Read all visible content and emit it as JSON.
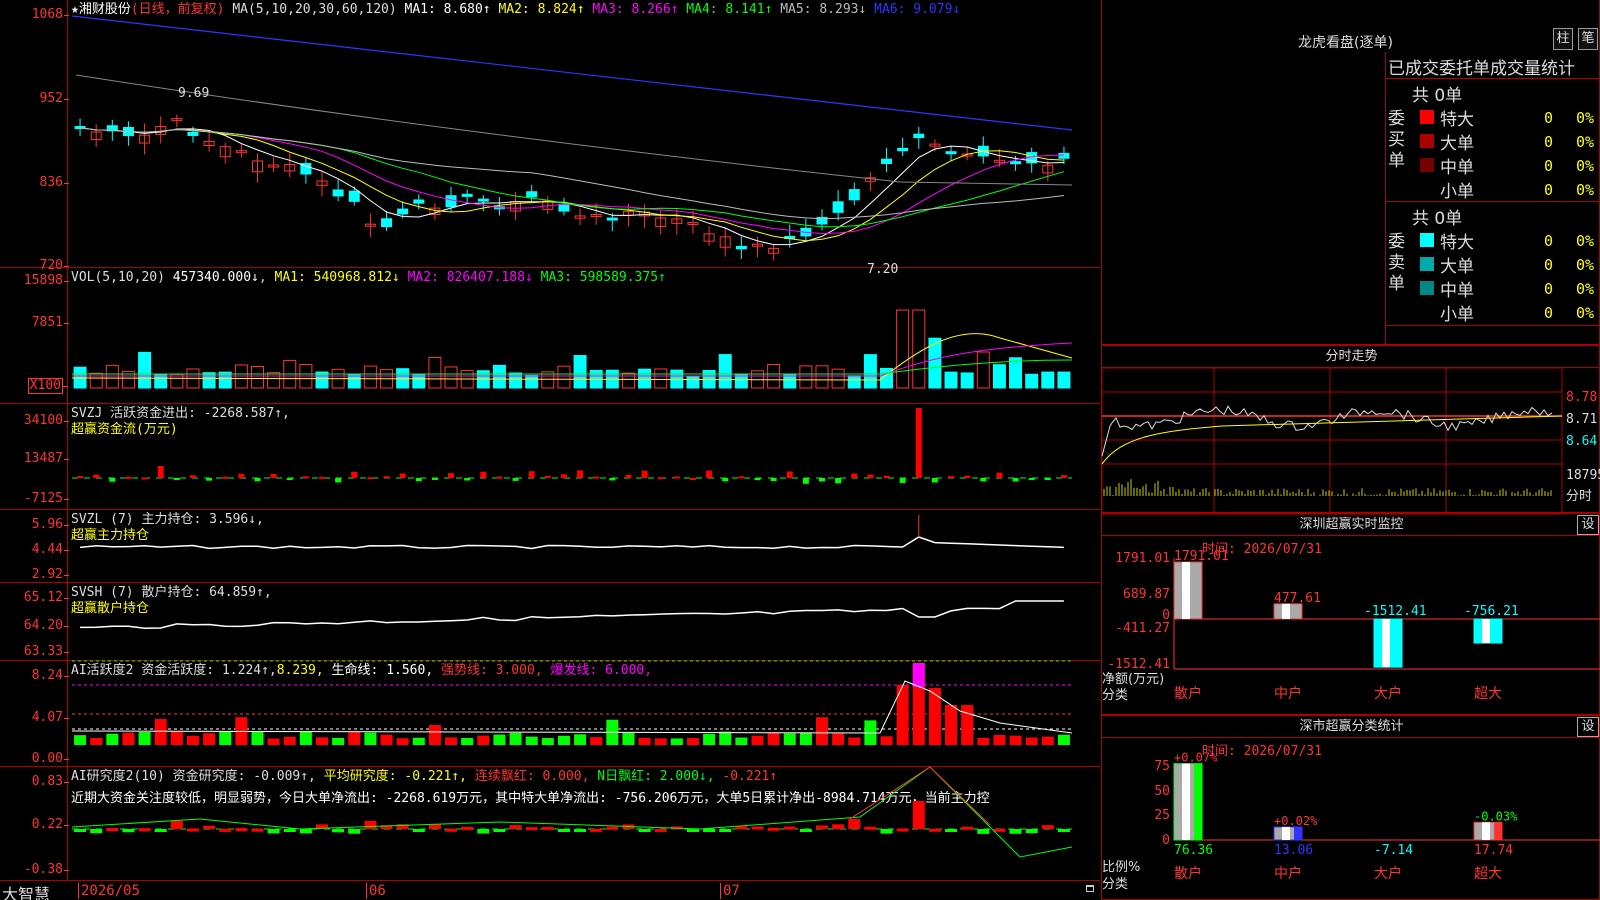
{
  "stock": {
    "star": "★",
    "name": "湘财股份",
    "period": "(日线，前复权)"
  },
  "ma": {
    "label": "MA(5,10,20,30,60,120)",
    "items": [
      {
        "t": "MA1: 8.680↑",
        "c": "#fff"
      },
      {
        "t": "MA2: 8.824↑",
        "c": "#ff0"
      },
      {
        "t": "MA3: 8.266↑",
        "c": "#f0f"
      },
      {
        "t": "MA4: 8.141↑",
        "c": "#0f0"
      },
      {
        "t": "MA5: 8.293↓",
        "c": "#bbb"
      },
      {
        "t": "MA6: 9.079↓",
        "c": "#33f"
      }
    ]
  },
  "price_axis": [
    "1068",
    "952",
    "836",
    "720"
  ],
  "price_marks": {
    "high": "9.69",
    "low": "7.20"
  },
  "vol": {
    "label": "VOL(5,10,20)",
    "v": "457340.000↓",
    "items": [
      {
        "t": "MA1: 540968.812↓",
        "c": "#ff0"
      },
      {
        "t": "MA2: 826407.188↓",
        "c": "#f0f"
      },
      {
        "t": "MA3: 598589.375↑",
        "c": "#0f0"
      }
    ],
    "axis": [
      "15898",
      "7851",
      "X100"
    ]
  },
  "svzj": {
    "line1": "SVZJ  活跃资金进出: -2268.587↑,",
    "line2": "超赢资金流(万元)",
    "axis": [
      "34100",
      "13487",
      "-7125"
    ]
  },
  "svzl": {
    "line1": "SVZL (7) 主力持仓: 3.596↓,",
    "line2": "超赢主力持仓",
    "axis": [
      "5.96",
      "4.44",
      "2.92"
    ]
  },
  "svsh": {
    "line1": "SVSH (7) 散户持仓: 64.859↑,",
    "line2": "超赢散户持仓",
    "axis": [
      "65.12",
      "64.20",
      "63.33"
    ]
  },
  "ai1": {
    "head": "AI活跃度2 资金活跃度: 1.224↑,",
    "v2": "8.239,",
    "v3": "生命线: 1.560,",
    "v4": "强势线: 3.000,",
    "v5": "爆发线: 6.000,",
    "axis": [
      "8.24",
      "4.07",
      "0.00"
    ]
  },
  "ai2": {
    "head": "AI研究度2(10) 资金研究度: -0.009↑,",
    "v2": "平均研究度: -0.221↑,",
    "v3": "连续飘红: 0.000,",
    "v4": "N日飘红: 2.000↓,",
    "v5": "-0.221↑",
    "note": "近期大资金关注度较低，明显弱势，今日大单净流出: -2268.619万元，其中特大单净流出: -756.206万元，大单5日累计净出-8984.714万元，当前主力控",
    "axis": [
      "0.83",
      "0.22",
      "-0.38"
    ]
  },
  "xaxis": {
    "brand": "大智慧",
    "labels": [
      "2026/05",
      "06",
      "07"
    ]
  },
  "right": {
    "lh_title": "龙虎看盘(逐单)",
    "btn_zhu": "柱",
    "btn_bi": "笔",
    "stat_title": "已成交委托单成交量统计",
    "buy_side": "委买单",
    "sell_side": "委卖单",
    "buy_total": "共 0单",
    "sell_total": "共 0单",
    "buy_rows": [
      {
        "n": "特大",
        "c": "#f00",
        "v": "0",
        "p": "0%"
      },
      {
        "n": "大单",
        "c": "#a00",
        "v": "0",
        "p": "0%"
      },
      {
        "n": "中单",
        "c": "#700",
        "v": "0",
        "p": "0%"
      },
      {
        "n": "小单",
        "c": "",
        "v": "0",
        "p": "0%"
      }
    ],
    "sell_rows": [
      {
        "n": "特大",
        "c": "#0ff",
        "v": "0",
        "p": "0%"
      },
      {
        "n": "大单",
        "c": "#0aa",
        "v": "0",
        "p": "0%"
      },
      {
        "n": "中单",
        "c": "#088",
        "v": "0",
        "p": "0%"
      },
      {
        "n": "小单",
        "c": "",
        "v": "0",
        "p": "0%"
      }
    ],
    "intraday_title": "分时走势",
    "intraday_axis": [
      "8.78",
      "8.71",
      "8.64",
      "18795",
      "分时"
    ],
    "sz_title": "深圳超赢实时监控",
    "set": "设",
    "sz_time": "时间: 2026/07/31",
    "sz_axis": [
      "1791.01",
      "689.87",
      "0",
      "-411.27",
      "-1512.41"
    ],
    "sz_unit": "净额(万元)",
    "sz_cat": "分类",
    "sz_bars": [
      {
        "cat": "散户",
        "v": 1791.01,
        "lab": "1791.01"
      },
      {
        "cat": "中户",
        "v": 477.61,
        "lab": "477.61"
      },
      {
        "cat": "大户",
        "v": -1512.41,
        "lab": "-1512.41"
      },
      {
        "cat": "超大",
        "v": -756.21,
        "lab": "-756.21"
      }
    ],
    "cls_title": "深市超赢分类统计",
    "cls_time": "时间: 2026/07/31",
    "cls_axis": [
      "75",
      "50",
      "25",
      "0"
    ],
    "cls_unit": "比例%",
    "cls_cat": "分类",
    "cls_bars": [
      {
        "cat": "散户",
        "top": "+0.07%",
        "bot": "76.36",
        "v": 76.36
      },
      {
        "cat": "中户",
        "top": "+0.02%",
        "bot": "13.06",
        "v": 13.06
      },
      {
        "cat": "大户",
        "top": "",
        "bot": "-7.14",
        "v": 0
      },
      {
        "cat": "超大",
        "top": "-0.03%",
        "bot": "17.74",
        "v": 17.74
      }
    ]
  },
  "colors": {
    "up": "#f33",
    "down": "#0ff",
    "grid": "#a00"
  }
}
